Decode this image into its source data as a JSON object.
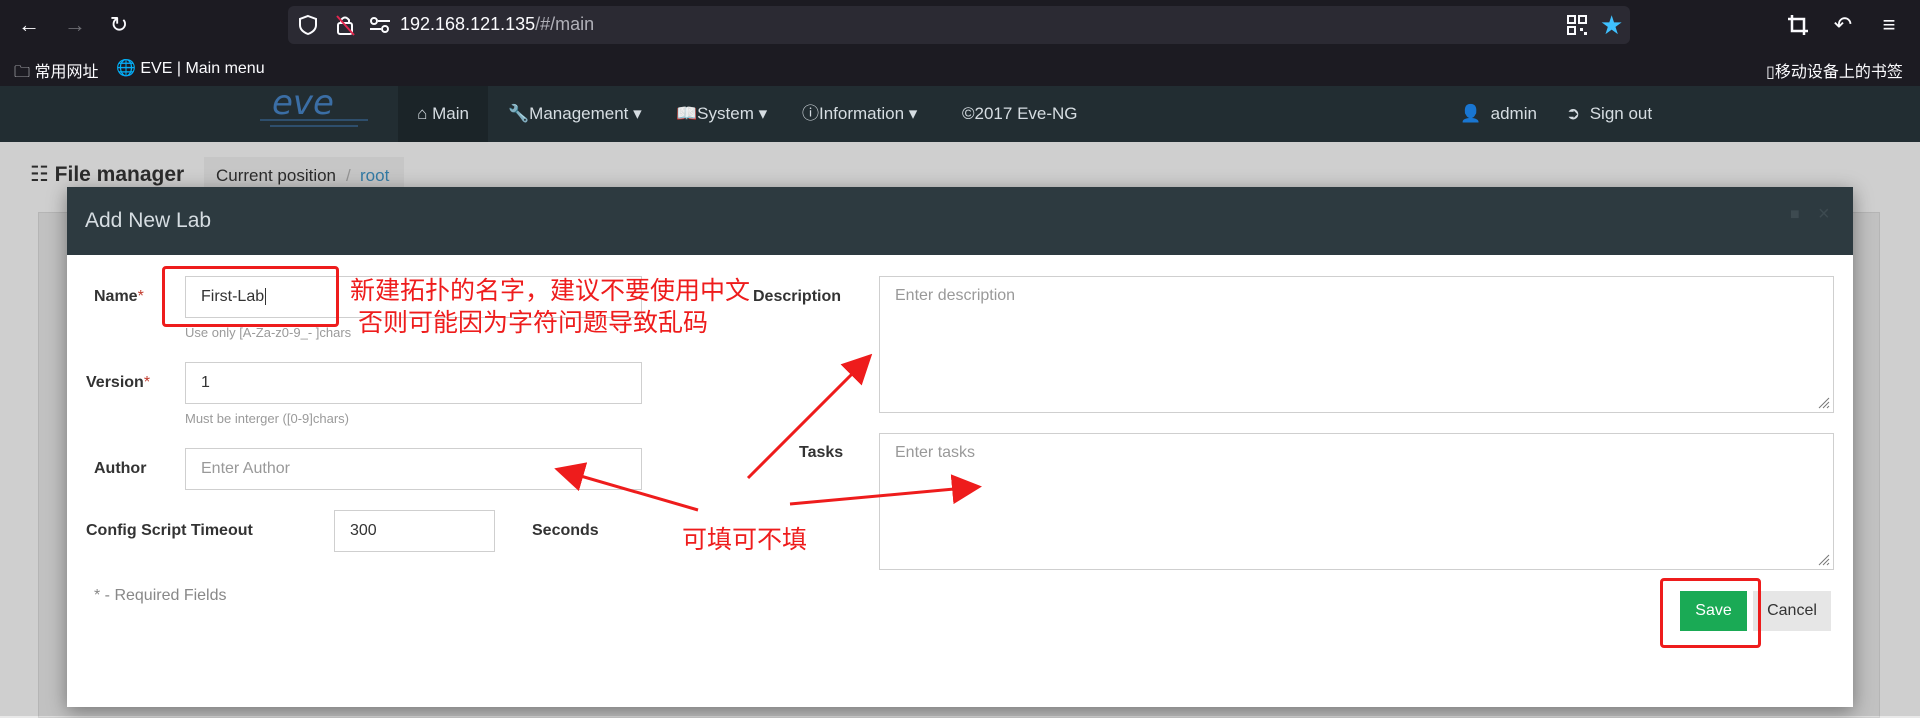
{
  "browser": {
    "url_host": "192.168.121.135",
    "url_path": "/#/main",
    "bookmarks": [
      "常用网址",
      "EVE | Main menu"
    ],
    "mobile_bookmarks": "移动设备上的书签"
  },
  "navbar": {
    "items": [
      "Main",
      "Management",
      "System",
      "Information",
      "©2017 Eve-NG"
    ],
    "user": "admin",
    "sign_out": "Sign out"
  },
  "page": {
    "title": "File manager",
    "breadcrumb_label": "Current position",
    "breadcrumb_root": "root"
  },
  "modal": {
    "title": "Add New Lab",
    "name_label": "Name",
    "name_value": "First-Lab",
    "name_help": "Use only [A-Za-z0-9_- ]chars",
    "version_label": "Version",
    "version_value": "1",
    "version_help": "Must be interger ([0-9]chars)",
    "author_label": "Author",
    "author_placeholder": "Enter Author",
    "timeout_label": "Config Script Timeout",
    "timeout_value": "300",
    "seconds_label": "Seconds",
    "description_label": "Description",
    "description_placeholder": "Enter description",
    "tasks_label": "Tasks",
    "tasks_placeholder": "Enter tasks",
    "required_note": "* - Required Fields",
    "save": "Save",
    "cancel": "Cancel",
    "required_mark": "*"
  },
  "annotations": {
    "name_note_line1": "新建拓扑的名字，建议不要使用中文",
    "name_note_line2": "否则可能因为字符问题导致乱码",
    "optional_note": "可填可不填",
    "color": "#ee1c1c"
  }
}
